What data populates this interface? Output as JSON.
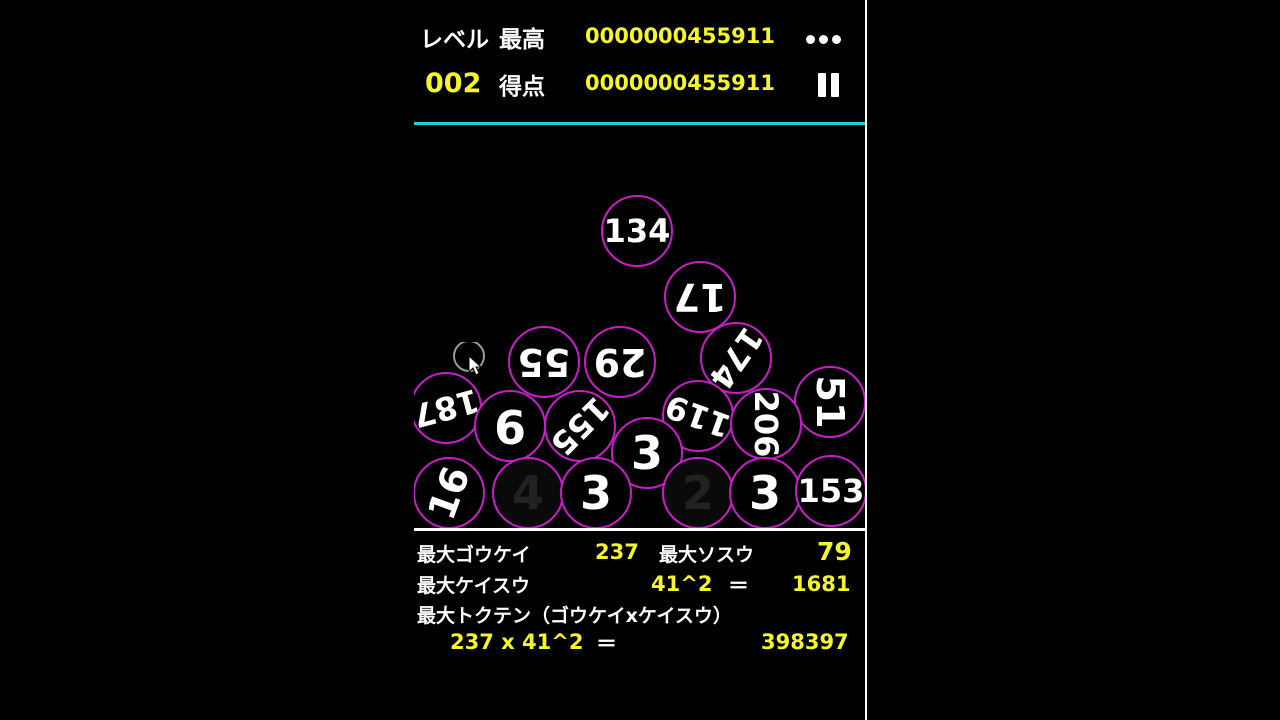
{
  "header": {
    "level_label": "レベル",
    "level_value": "002",
    "best_label": "最高",
    "best_value": "0000000455911",
    "score_label": "得点",
    "score_value": "0000000455911"
  },
  "icons": {
    "menu": "more-dots-icon",
    "pause": "pause-icon",
    "cursor": "mouse-cursor-icon"
  },
  "colors": {
    "ball_stroke": "#c81ec8",
    "text_yellow": "#f5f52a",
    "top_line": "#1ed2d2"
  },
  "balls": [
    {
      "value": "134",
      "rot": 0,
      "fill": "#000000"
    },
    {
      "value": "17",
      "rot": 180,
      "fill": "#000000"
    },
    {
      "value": "55",
      "rot": 180,
      "fill": "#000000"
    },
    {
      "value": "29",
      "rot": 180,
      "fill": "#000000"
    },
    {
      "value": "174",
      "rot": 125,
      "fill": "#000000"
    },
    {
      "value": "187",
      "rot": 165,
      "fill": "#000000"
    },
    {
      "value": "51",
      "rot": 90,
      "fill": "#000000"
    },
    {
      "value": "9",
      "rot": 180,
      "fill": "#000000"
    },
    {
      "value": "155",
      "rot": 135,
      "fill": "#000000"
    },
    {
      "value": "119",
      "rot": 200,
      "fill": "#000000"
    },
    {
      "value": "206",
      "rot": 90,
      "fill": "#000000"
    },
    {
      "value": "3",
      "rot": 0,
      "fill": "#000000"
    },
    {
      "value": "16",
      "rot": -70,
      "fill": "#000000"
    },
    {
      "value": "4",
      "rot": 0,
      "fill": "#0a0a0a"
    },
    {
      "value": "3",
      "rot": 0,
      "fill": "#000000"
    },
    {
      "value": "2",
      "rot": 0,
      "fill": "#0a0a0a"
    },
    {
      "value": "3",
      "rot": 0,
      "fill": "#000000"
    },
    {
      "value": "153",
      "rot": 0,
      "fill": "#000000"
    }
  ],
  "stats": {
    "max_sum_label": "最大ゴウケイ",
    "max_sum_value": "237",
    "max_prime_label": "最大ソスウ",
    "max_prime_value": "79",
    "max_coef_label": "最大ケイスウ",
    "max_coef_expr": "41^2",
    "max_coef_eq": "＝",
    "max_coef_value": "1681",
    "max_score_label": "最大トクテン（ゴウケイxケイスウ）",
    "max_score_expr": "237 x 41^2",
    "max_score_eq": "＝",
    "max_score_value": "398397"
  }
}
